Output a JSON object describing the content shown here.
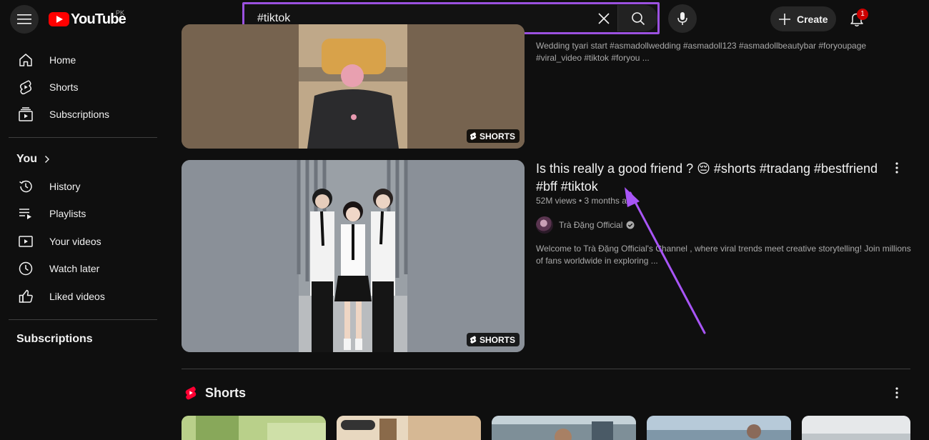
{
  "header": {
    "logo_text": "YouTube",
    "country_code": "PK",
    "search_value": "#tiktok",
    "create_label": "Create",
    "notification_count": "1"
  },
  "sidebar": {
    "main_items": [
      {
        "label": "Home",
        "icon": "home-icon"
      },
      {
        "label": "Shorts",
        "icon": "shorts-icon"
      },
      {
        "label": "Subscriptions",
        "icon": "subscriptions-icon"
      }
    ],
    "you_heading": "You",
    "you_items": [
      {
        "label": "History",
        "icon": "history-icon"
      },
      {
        "label": "Playlists",
        "icon": "playlists-icon"
      },
      {
        "label": "Your videos",
        "icon": "your-videos-icon"
      },
      {
        "label": "Watch later",
        "icon": "watch-later-icon"
      },
      {
        "label": "Liked videos",
        "icon": "liked-videos-icon"
      }
    ],
    "subscriptions_heading": "Subscriptions"
  },
  "results": [
    {
      "badge": "SHORTS",
      "description": "Wedding tyari start #asmadollwedding #asmadoll123 #asmadollbeautybar #foryoupage #viral_video #tiktok #foryou ..."
    },
    {
      "badge": "SHORTS",
      "title": "Is this really a good friend ? 😔 #shorts #tradang #bestfriend #bff #tiktok",
      "meta": "52M views • 3 months ago",
      "channel": "Trà Đặng Official",
      "description": "Welcome to Trà Đặng Official's Channel , where viral trends meet creative storytelling! Join millions of fans worldwide in exploring ..."
    }
  ],
  "shorts_section": {
    "heading": "Shorts"
  },
  "colors": {
    "background": "#0f0f0f",
    "highlight": "#9b51e0",
    "brand_red": "#ff0000"
  }
}
